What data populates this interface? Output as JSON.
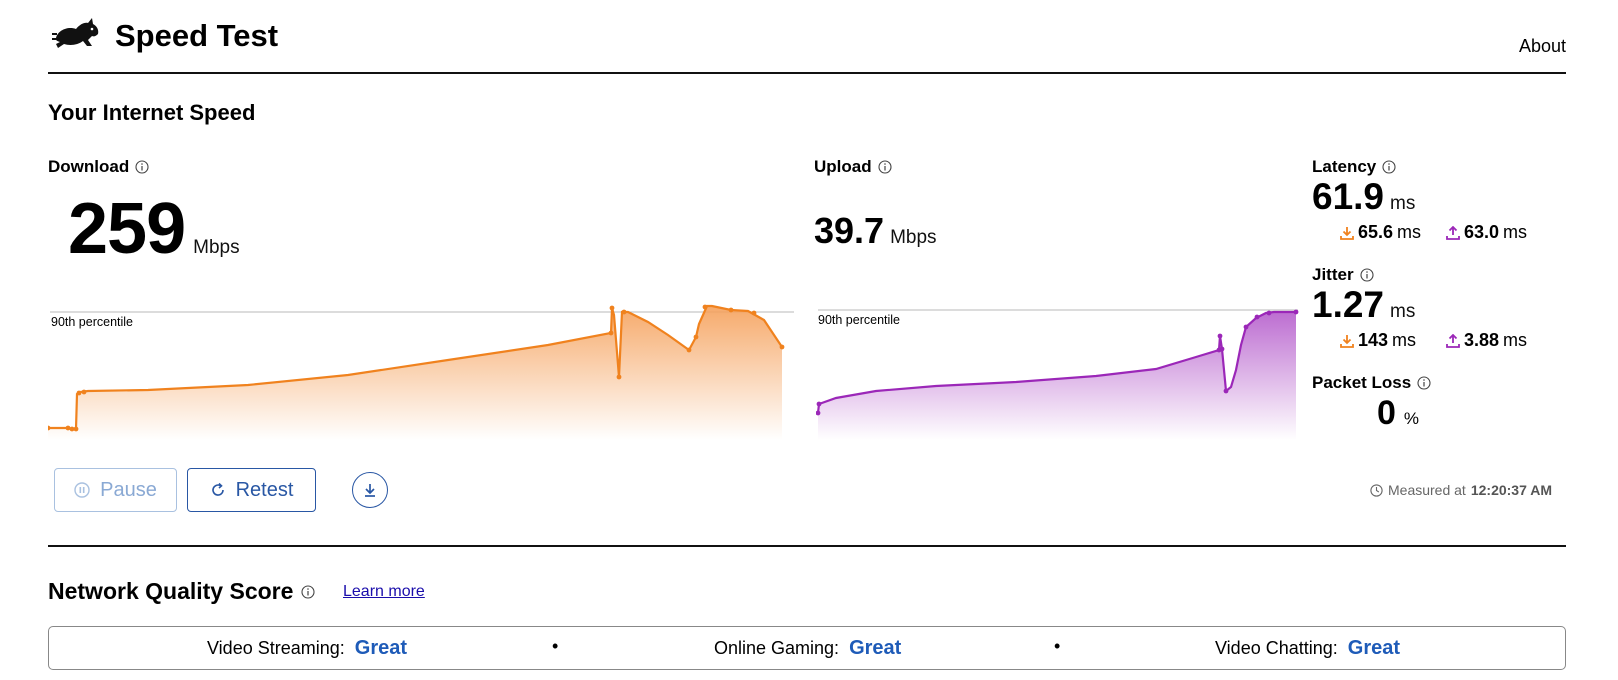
{
  "app": {
    "title": "Speed Test",
    "about_label": "About"
  },
  "speed": {
    "section_title": "Your Internet Speed",
    "download": {
      "label": "Download",
      "value": "259",
      "unit": "Mbps",
      "percentile_label": "90th percentile"
    },
    "upload": {
      "label": "Upload",
      "value": "39.7",
      "unit": "Mbps",
      "percentile_label": "90th percentile"
    },
    "latency": {
      "label": "Latency",
      "value": "61.9",
      "unit": "ms",
      "down_value": "65.6",
      "down_unit": "ms",
      "up_value": "63.0",
      "up_unit": "ms"
    },
    "jitter": {
      "label": "Jitter",
      "value": "1.27",
      "unit": "ms",
      "down_value": "143",
      "down_unit": "ms",
      "up_value": "3.88",
      "up_unit": "ms"
    },
    "packet_loss": {
      "label": "Packet Loss",
      "value": "0",
      "unit": "%"
    }
  },
  "controls": {
    "pause_label": "Pause",
    "retest_label": "Retest"
  },
  "measured": {
    "prefix": "Measured at",
    "time": "12:20:37 AM"
  },
  "network_quality": {
    "title": "Network Quality Score",
    "learn_more": "Learn more",
    "items": [
      {
        "label": "Video Streaming:",
        "value": "Great"
      },
      {
        "label": "Online Gaming:",
        "value": "Great"
      },
      {
        "label": "Video Chatting:",
        "value": "Great"
      }
    ],
    "separator": "•"
  },
  "colors": {
    "download": "#f0821e",
    "upload": "#9b27b8",
    "accent": "#2957a4",
    "score_value": "#1e5bb8"
  }
}
